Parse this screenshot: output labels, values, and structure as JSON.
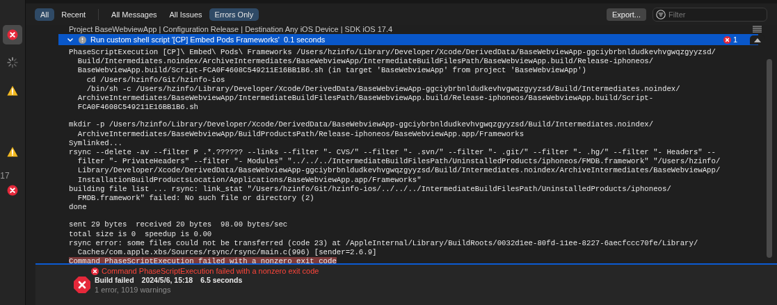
{
  "sidebar": {
    "items": [
      {
        "kind": "error",
        "selected": true
      },
      {
        "kind": "spinner",
        "selected": false
      },
      {
        "kind": "warning",
        "selected": false
      },
      {
        "kind": "warning",
        "selected": false
      },
      {
        "kind": "error",
        "selected": false,
        "count": "17"
      }
    ]
  },
  "toolbar": {
    "scope_tabs": [
      {
        "label": "All",
        "selected": true
      },
      {
        "label": "Recent",
        "selected": false
      }
    ],
    "filter_tabs": [
      {
        "label": "All Messages",
        "selected": false
      },
      {
        "label": "All Issues",
        "selected": false
      },
      {
        "label": "Errors Only",
        "selected": true
      }
    ],
    "export_button": "Export...",
    "filter": {
      "placeholder": "Filter"
    }
  },
  "project_line": "Project BaseWebviewApp | Configuration Release | Destination Any iOS Device | SDK iOS 17.4",
  "step": {
    "expanded": true,
    "selected": true,
    "title": "Run custom shell script '[CP] Embed Pods Frameworks'",
    "duration": "0.1 seconds",
    "error_count": "1"
  },
  "log_groups": [
    [
      {
        "kind": "line",
        "text": "PhaseScriptExecution [CP]\\ Embed\\ Pods\\ Frameworks /Users/hzinfo/Library/Developer/Xcode/DerivedData/BaseWebviewApp-ggciybrbnldudkevhvgwqzgyyzsd/"
      },
      {
        "kind": "wrap",
        "text": "Build/Intermediates.noindex/ArchiveIntermediates/BaseWebviewApp/IntermediateBuildFilesPath/BaseWebviewApp.build/Release-iphoneos/"
      },
      {
        "kind": "wrap",
        "text": "BaseWebviewApp.build/Script-FCA0F4608C549211E16BB1B6.sh (in target 'BaseWebviewApp' from project 'BaseWebviewApp')"
      },
      {
        "kind": "sub",
        "text": "cd /Users/hzinfo/Git/hzinfo-ios"
      },
      {
        "kind": "sub",
        "text": "/bin/sh -c /Users/hzinfo/Library/Developer/Xcode/DerivedData/BaseWebviewApp-ggciybrbnldudkevhvgwqzgyyzsd/Build/Intermediates.noindex/"
      },
      {
        "kind": "wrap",
        "text": "ArchiveIntermediates/BaseWebviewApp/IntermediateBuildFilesPath/BaseWebviewApp.build/Release-iphoneos/BaseWebviewApp.build/Script-"
      },
      {
        "kind": "wrap",
        "text": "FCA0F4608C549211E16BB1B6.sh"
      }
    ],
    [
      {
        "kind": "line",
        "text": "mkdir -p /Users/hzinfo/Library/Developer/Xcode/DerivedData/BaseWebviewApp-ggciybrbnldudkevhvgwqzgyyzsd/Build/Intermediates.noindex/"
      },
      {
        "kind": "wrap",
        "text": "ArchiveIntermediates/BaseWebviewApp/BuildProductsPath/Release-iphoneos/BaseWebviewApp.app/Frameworks"
      },
      {
        "kind": "line",
        "text": "Symlinked..."
      },
      {
        "kind": "line",
        "text": "rsync --delete -av --filter P .*.?????? --links --filter \"- CVS/\" --filter \"- .svn/\" --filter \"- .git/\" --filter \"- .hg/\" --filter \"- Headers\" --"
      },
      {
        "kind": "wrap",
        "text": "filter \"- PrivateHeaders\" --filter \"- Modules\" \"../../../IntermediateBuildFilesPath/UninstalledProducts/iphoneos/FMDB.framework\" \"/Users/hzinfo/"
      },
      {
        "kind": "wrap",
        "text": "Library/Developer/Xcode/DerivedData/BaseWebviewApp-ggciybrbnldudkevhvgwqzgyyzsd/Build/Intermediates.noindex/ArchiveIntermediates/BaseWebviewApp/"
      },
      {
        "kind": "wrap",
        "text": "InstallationBuildProductsLocation/Applications/BaseWebviewApp.app/Frameworks\""
      },
      {
        "kind": "line",
        "text": "building file list ... rsync: link_stat \"/Users/hzinfo/Git/hzinfo-ios/../../../IntermediateBuildFilesPath/UninstalledProducts/iphoneos/"
      },
      {
        "kind": "wrap",
        "text": "FMDB.framework\" failed: No such file or directory (2)"
      },
      {
        "kind": "line",
        "text": "done"
      }
    ],
    [
      {
        "kind": "line",
        "text": "sent 29 bytes  received 20 bytes  98.00 bytes/sec"
      },
      {
        "kind": "line",
        "text": "total size is 0  speedup is 0.00"
      },
      {
        "kind": "line",
        "text": "rsync error: some files could not be transferred (code 23) at /AppleInternal/Library/BuildRoots/0032d1ee-80fd-11ee-8227-6aecfccc70fe/Library/"
      },
      {
        "kind": "wrap",
        "text": "Caches/com.apple.xbs/Sources/rsync/rsync/main.c(996) [sender=2.6.9]"
      },
      {
        "kind": "error",
        "text": "Command PhaseScriptExecution failed with a nonzero exit code"
      }
    ]
  ],
  "error_message": "Command PhaseScriptExecution failed with a nonzero exit code",
  "result": {
    "title": "Build failed",
    "date": "2024/5/6, 15:18",
    "duration": "6.5 seconds",
    "summary": "1 error, 1019 warnings"
  }
}
